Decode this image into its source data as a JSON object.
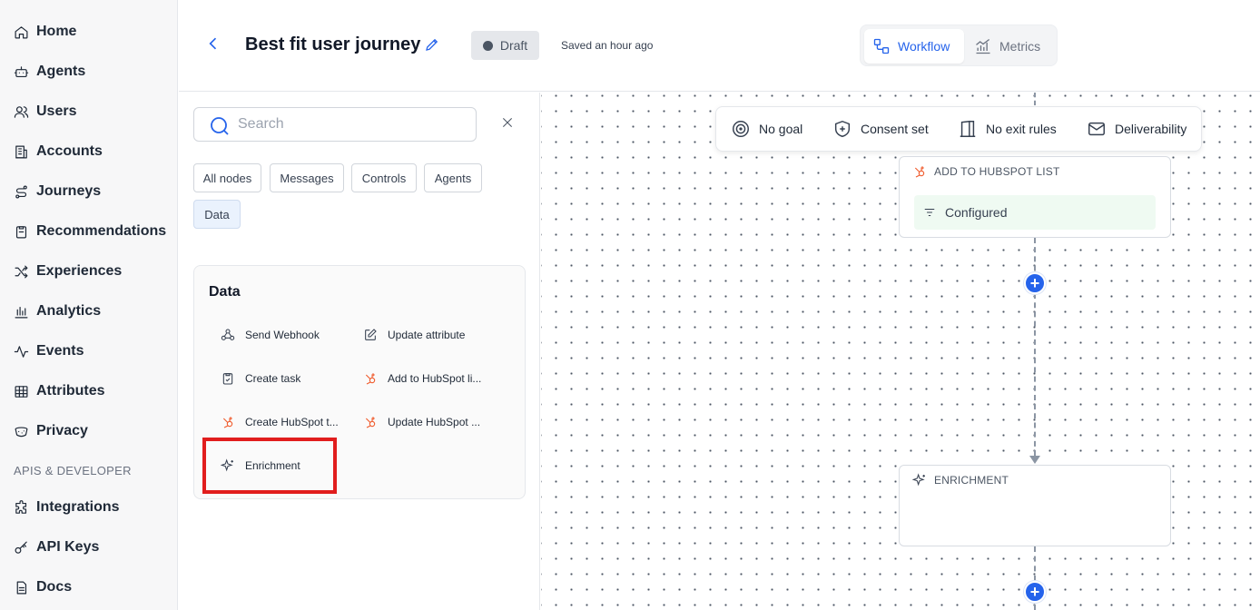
{
  "sidebar": {
    "items": [
      {
        "label": "Home",
        "icon": "home-icon"
      },
      {
        "label": "Agents",
        "icon": "bot-icon"
      },
      {
        "label": "Users",
        "icon": "users-icon"
      },
      {
        "label": "Accounts",
        "icon": "building-icon"
      },
      {
        "label": "Journeys",
        "icon": "route-icon"
      },
      {
        "label": "Recommendations",
        "icon": "clipboard-icon"
      },
      {
        "label": "Experiences",
        "icon": "shuffle-icon"
      },
      {
        "label": "Analytics",
        "icon": "bar-chart-icon"
      },
      {
        "label": "Events",
        "icon": "activity-icon"
      },
      {
        "label": "Attributes",
        "icon": "table-icon"
      },
      {
        "label": "Privacy",
        "icon": "cookie-icon"
      }
    ],
    "section_label": "APIS & DEVELOPER",
    "dev_items": [
      {
        "label": "Integrations",
        "icon": "puzzle-icon"
      },
      {
        "label": "API Keys",
        "icon": "key-icon"
      },
      {
        "label": "Docs",
        "icon": "document-icon"
      }
    ]
  },
  "header": {
    "title": "Best fit user journey",
    "status": "Draft",
    "saved": "Saved an hour ago",
    "tabs": {
      "workflow": "Workflow",
      "metrics": "Metrics"
    }
  },
  "panel": {
    "search_placeholder": "Search",
    "filters": [
      "All nodes",
      "Messages",
      "Controls",
      "Agents",
      "Data"
    ],
    "active_filter": "Data",
    "card_title": "Data",
    "nodes": [
      {
        "label": "Send Webhook",
        "icon": "webhook-icon"
      },
      {
        "label": "Update attribute",
        "icon": "edit-icon"
      },
      {
        "label": "Create task",
        "icon": "clipboard-check-icon"
      },
      {
        "label": "Add to HubSpot li...",
        "icon": "hubspot-icon"
      },
      {
        "label": "Create HubSpot t...",
        "icon": "hubspot-icon"
      },
      {
        "label": "Update HubSpot ...",
        "icon": "hubspot-icon"
      },
      {
        "label": "Enrichment",
        "icon": "sparkles-icon"
      }
    ]
  },
  "canvas": {
    "toolbar": {
      "goal": "No goal",
      "consent": "Consent set",
      "exit": "No exit rules",
      "deliverability": "Deliverability"
    },
    "nodes": {
      "hubspot_title": "ADD TO HUBSPOT LIST",
      "hubspot_status": "Configured",
      "enrichment_title": "ENRICHMENT"
    },
    "plus": "+"
  },
  "colors": {
    "accent": "#2563eb",
    "hubspot": "#f0592a",
    "highlight": "#e11d1d",
    "configured_bg": "#effaf2"
  }
}
